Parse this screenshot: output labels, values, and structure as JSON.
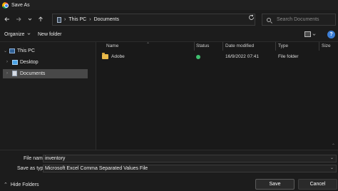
{
  "window": {
    "title": "Save As",
    "app_icon": "chrome-icon"
  },
  "navigation": {
    "back_icon": "arrow-left-icon",
    "forward_icon": "arrow-right-icon",
    "recent_icon": "chevron-down-icon",
    "up_icon": "arrow-up-icon",
    "breadcrumb": [
      "This PC",
      "Documents"
    ],
    "refresh_icon": "refresh-icon",
    "search_placeholder": "Search Documents"
  },
  "commandbar": {
    "organize_label": "Organize",
    "new_folder_label": "New folder",
    "help_label": "?"
  },
  "nav_pane": {
    "items": [
      {
        "label": "This PC",
        "expanded": true
      },
      {
        "label": "Desktop",
        "expanded": false
      },
      {
        "label": "Documents",
        "expanded": false,
        "selected": true
      }
    ]
  },
  "file_list": {
    "columns": [
      "Name",
      "Status",
      "Date modified",
      "Type",
      "Size"
    ],
    "rows": [
      {
        "name": "Adobe",
        "status": "synced",
        "date_modified": "16/9/2022 07:41",
        "type": "File folder",
        "size": ""
      }
    ]
  },
  "save_form": {
    "filename_label": "File name:",
    "filename_value": "inventory",
    "savetype_label": "Save as type:",
    "savetype_value": "Microsoft Excel Comma Separated Values File",
    "hide_folders_label": "Hide Folders",
    "save_label": "Save",
    "cancel_label": "Cancel"
  },
  "colors": {
    "accent": "#3d7fd6",
    "folder": "#e8b94a",
    "status_ok": "#3fbf6f"
  }
}
